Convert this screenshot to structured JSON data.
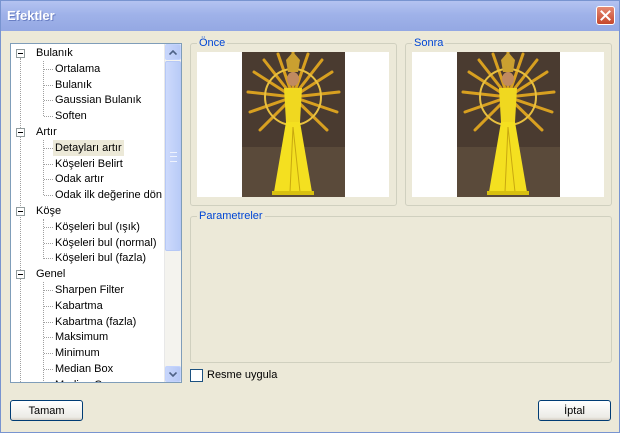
{
  "window": {
    "title": "Efektler"
  },
  "tree": {
    "categories": [
      {
        "label": "Bulanık",
        "items": [
          "Ortalama",
          "Bulanık",
          "Gaussian Bulanık",
          "Soften"
        ]
      },
      {
        "label": "Artır",
        "items": [
          "Detayları artır",
          "Köşeleri Belirt",
          "Odak artır",
          "Odak ilk değerine dön"
        ]
      },
      {
        "label": "Köşe",
        "items": [
          "Köşeleri bul (ışık)",
          "Köşeleri bul (normal)",
          "Köşeleri bul (fazla)"
        ]
      },
      {
        "label": "Genel",
        "items": [
          "Sharpen Filter",
          "Kabartma",
          "Kabartma (fazla)",
          "Maksimum",
          "Minimum",
          "Median Box",
          "Median Cross"
        ]
      }
    ],
    "selected": "Detayları artır"
  },
  "before": {
    "label": "Önce"
  },
  "after": {
    "label": "Sonra"
  },
  "parameters": {
    "label": "Parametreler"
  },
  "apply_checkbox": {
    "label": "Resme uygula",
    "checked": false
  },
  "buttons": {
    "ok": "Tamam",
    "cancel": "İptal"
  },
  "colors": {
    "group_label": "#0046d5",
    "title_bar": "#9fb2e9",
    "window_bg": "#ece9d8"
  }
}
